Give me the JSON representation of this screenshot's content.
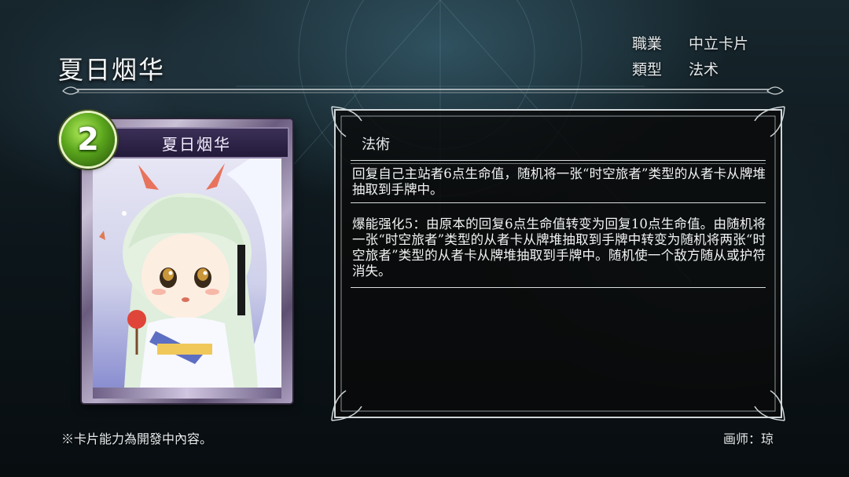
{
  "header": {
    "card_name": "夏日烟华",
    "class_label": "職業",
    "class_value": "中立卡片",
    "type_label": "類型",
    "type_value": "法术"
  },
  "card": {
    "cost": "2",
    "name": "夏日烟华",
    "cost_color": "#5aa51c",
    "art_icon": "chibi-girl-with-horns-illustration"
  },
  "description": {
    "type_heading": "法術",
    "effect": "回复自己主站者6点生命值，随机将一张“时空旅者”类型的从者卡从牌堆抽取到手牌中。",
    "enhance": "爆能强化5：由原本的回复6点生命值转变为回复10点生命值。由随机将一张“时空旅者”类型的从者卡从牌堆抽取到手牌中转变为随机将两张“时空旅者”类型的从者卡从牌堆抽取到手牌中。随机使一个敌方随从或护符消失。"
  },
  "footer": {
    "note": "※卡片能力為開發中內容。",
    "artist": "画师：琼"
  }
}
